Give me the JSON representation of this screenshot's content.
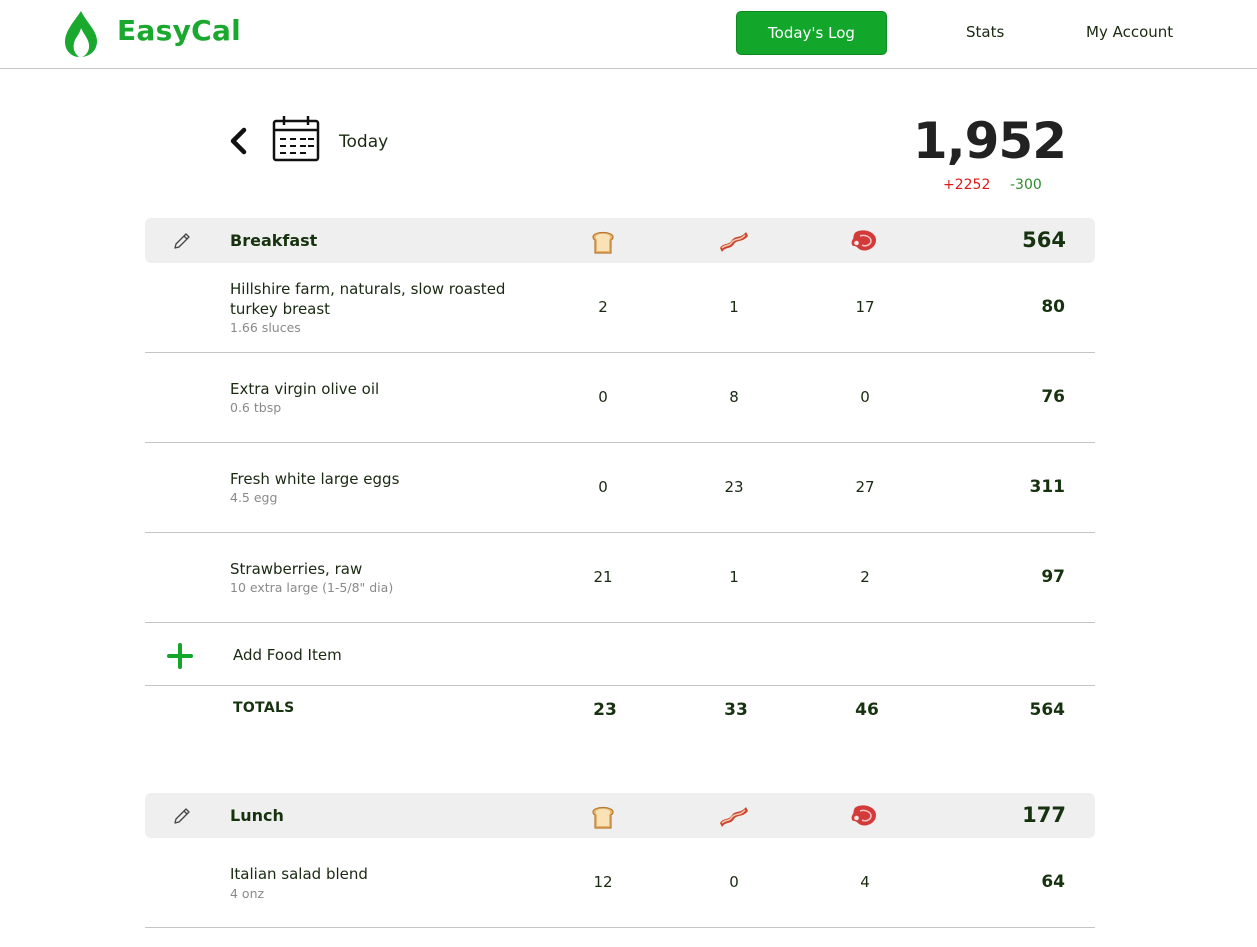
{
  "header": {
    "brand": "EasyCal",
    "nav": {
      "todays_log": "Today's Log",
      "stats": "Stats",
      "my_account": "My Account"
    },
    "accent_color": "#12a62b"
  },
  "date_bar": {
    "label": "Today",
    "total_calories": "1,952",
    "delta_plus": "+2252",
    "delta_minus": "-300"
  },
  "macro_icons": [
    "bread-icon",
    "bacon-icon",
    "meat-icon"
  ],
  "meals": [
    {
      "name": "Breakfast",
      "total": "564",
      "items": [
        {
          "name": "Hillshire farm, naturals, slow roasted turkey breast",
          "serving": "1.66 sluces",
          "carbs": "2",
          "fat": "1",
          "protein": "17",
          "calories": "80"
        },
        {
          "name": "Extra virgin olive oil",
          "serving": "0.6 tbsp",
          "carbs": "0",
          "fat": "8",
          "protein": "0",
          "calories": "76"
        },
        {
          "name": "Fresh white large eggs",
          "serving": "4.5 egg",
          "carbs": "0",
          "fat": "23",
          "protein": "27",
          "calories": "311"
        },
        {
          "name": "Strawberries, raw",
          "serving": "10 extra large (1-5/8\" dia)",
          "carbs": "21",
          "fat": "1",
          "protein": "2",
          "calories": "97"
        }
      ],
      "add_label": "Add Food Item",
      "totals": {
        "label": "TOTALS",
        "carbs": "23",
        "fat": "33",
        "protein": "46",
        "calories": "564"
      }
    },
    {
      "name": "Lunch",
      "total": "177",
      "items": [
        {
          "name": "Italian salad blend",
          "serving": "4 onz",
          "carbs": "12",
          "fat": "0",
          "protein": "4",
          "calories": "64"
        }
      ]
    }
  ]
}
